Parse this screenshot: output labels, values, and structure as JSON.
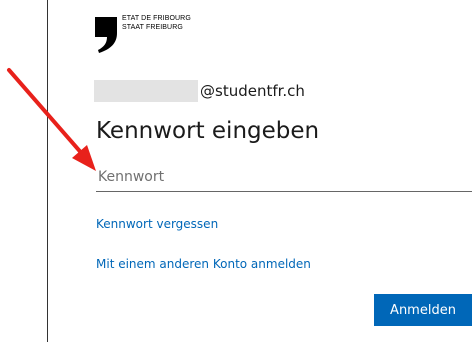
{
  "logo": {
    "line1": "ETAT DE FRIBOURG",
    "line2": "STAAT FREIBURG"
  },
  "account": {
    "email_domain": "@studentfr.ch"
  },
  "page_title": "Kennwort eingeben",
  "password": {
    "value": "",
    "placeholder": "Kennwort"
  },
  "links": {
    "forgot": "Kennwort vergessen",
    "other_account": "Mit einem anderen Konto anmelden"
  },
  "buttons": {
    "sign_in": "Anmelden"
  },
  "colors": {
    "accent": "#0067b8",
    "annotation_arrow": "#e8211b",
    "redaction": "#e3e3e3"
  }
}
